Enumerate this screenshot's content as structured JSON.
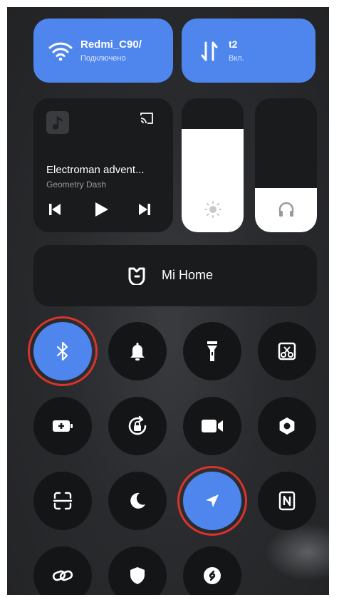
{
  "wifi": {
    "name": "Redmi_C90/",
    "status": "Подключено",
    "icon": "wifi-icon"
  },
  "data": {
    "name": "t2",
    "status": "Вкл.",
    "icon": "mobile-data-arrows-icon"
  },
  "media": {
    "title": "Electroman advent...",
    "artist": "Geometry Dash",
    "icons": [
      "album-art-icon",
      "cast-icon",
      "previous-icon",
      "play-icon",
      "next-icon"
    ]
  },
  "sliders": {
    "brightness": {
      "icon": "sun-icon",
      "level": 0.77
    },
    "volume": {
      "icon": "headphones-icon",
      "level": 0.4
    }
  },
  "mi_home": {
    "label": "Mi Home",
    "icon": "mi-home-icon"
  },
  "toggles": [
    {
      "name": "bluetooth",
      "icon": "bluetooth-icon",
      "active": true
    },
    {
      "name": "notifications",
      "icon": "bell-icon",
      "active": false
    },
    {
      "name": "flashlight",
      "icon": "flashlight-icon",
      "active": false
    },
    {
      "name": "screenshot",
      "icon": "scissors-screenshot-icon",
      "active": false
    },
    {
      "name": "battery-saver",
      "icon": "battery-plus-icon",
      "active": false
    },
    {
      "name": "rotation-lock",
      "icon": "rotation-lock-icon",
      "active": false
    },
    {
      "name": "screen-recorder",
      "icon": "video-camera-icon",
      "active": false
    },
    {
      "name": "settings",
      "icon": "hexagon-settings-icon",
      "active": false
    },
    {
      "name": "scanner",
      "icon": "scan-icon",
      "active": false
    },
    {
      "name": "dark-mode",
      "icon": "moon-icon",
      "active": false
    },
    {
      "name": "location",
      "icon": "location-arrow-icon",
      "active": true
    },
    {
      "name": "nfc",
      "icon": "nfc-icon",
      "active": false
    },
    {
      "name": "link",
      "icon": "link-icon",
      "active": false
    },
    {
      "name": "security",
      "icon": "shield-icon",
      "active": false
    },
    {
      "name": "shazam",
      "icon": "shazam-icon",
      "active": false
    }
  ],
  "colors": {
    "accent": "#4f86ee",
    "highlight_ring": "#d9342b",
    "tile": "#1a1b1d"
  }
}
